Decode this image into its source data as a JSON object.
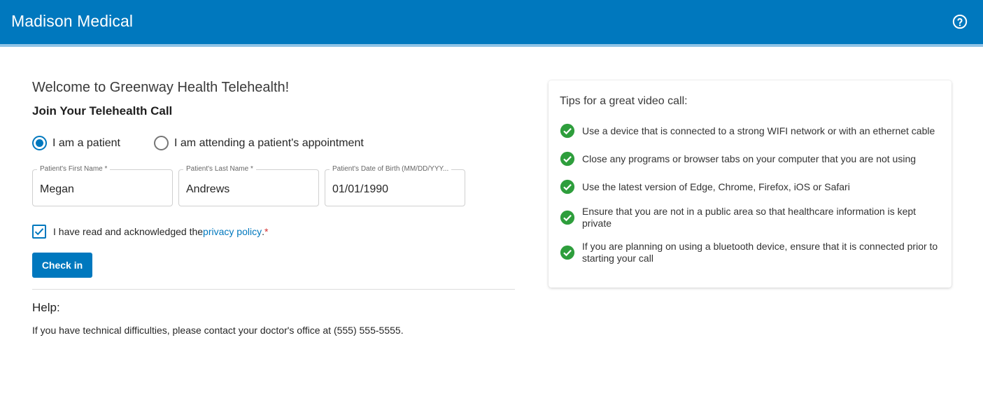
{
  "header": {
    "title": "Madison Medical",
    "help_icon": "help-circle-icon",
    "color": "#0078be"
  },
  "form": {
    "welcome": "Welcome to Greenway Health Telehealth!",
    "heading": "Join Your Telehealth Call",
    "radios": [
      {
        "label": "I am a patient",
        "selected": true
      },
      {
        "label": "I am attending a patient's appointment",
        "selected": false
      }
    ],
    "fields": [
      {
        "label": "Patient's First Name *",
        "value": "Megan"
      },
      {
        "label": "Patient's Last Name *",
        "value": "Andrews"
      },
      {
        "label": "Patient's Date of Birth (MM/DD/YYY...",
        "value": "01/01/1990"
      }
    ],
    "ack": {
      "checked": true,
      "text": "I have read and acknowledged the ",
      "link": "privacy policy",
      "suffix": ".",
      "required_mark": "*"
    },
    "button": "Check in"
  },
  "help": {
    "title": "Help:",
    "text": "If you have technical difficulties, please contact your doctor's office at (555) 555-5555."
  },
  "tips": {
    "title": "Tips for a great video call:",
    "icon": "check-circle-icon",
    "icon_color": "#2e9e3c",
    "items": [
      "Use a device that is connected to a strong WIFI network or with an ethernet cable",
      "Close any programs or browser tabs on your computer that you are not using",
      "Use the latest version of Edge, Chrome, Firefox, iOS or Safari",
      "Ensure that you are not in a public area so that healthcare information is kept private",
      "If you are planning on using a bluetooth device, ensure that it is connected prior to starting your call"
    ]
  }
}
